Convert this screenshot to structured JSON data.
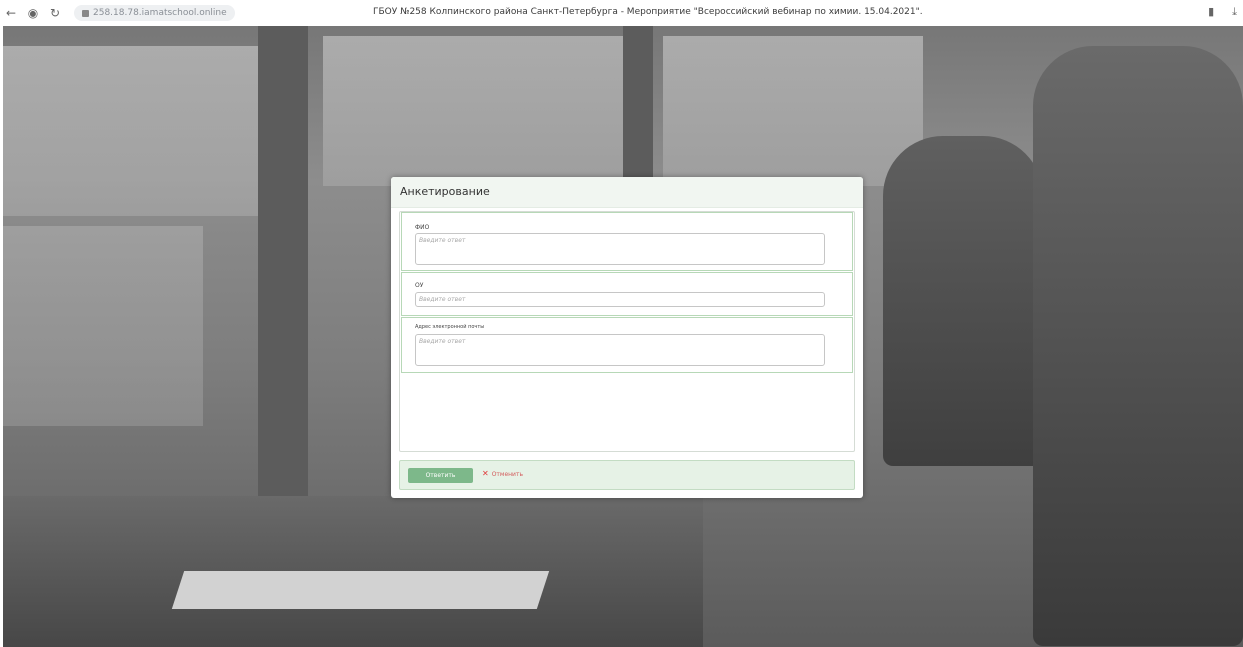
{
  "browser": {
    "url": "258.18.78.iamatschool.online",
    "tab_title": "ГБОУ №258 Колпинского района Санкт-Петербурга - Мероприятие \"Всероссийский вебинар по химии. 15.04.2021\".",
    "icons": [
      "back-arrow-icon",
      "extension-icon",
      "reload-icon",
      "lock-icon",
      "bookmark-icon",
      "download-icon"
    ]
  },
  "modal": {
    "title": "Анкетирование",
    "questions": [
      {
        "label": "ФИО",
        "placeholder": "Введите ответ"
      },
      {
        "label": "ОУ",
        "placeholder": "Введите ответ"
      },
      {
        "label": "Адрес электронной почты",
        "placeholder": "Введите ответ"
      }
    ],
    "submit_label": "Ответить",
    "cancel_label": "Отменить"
  },
  "colors": {
    "submit_button": "#7db88a",
    "footer_background": "#e6f2e6",
    "cancel_text": "#d35b5b",
    "question_border": "#b7d8b7"
  }
}
